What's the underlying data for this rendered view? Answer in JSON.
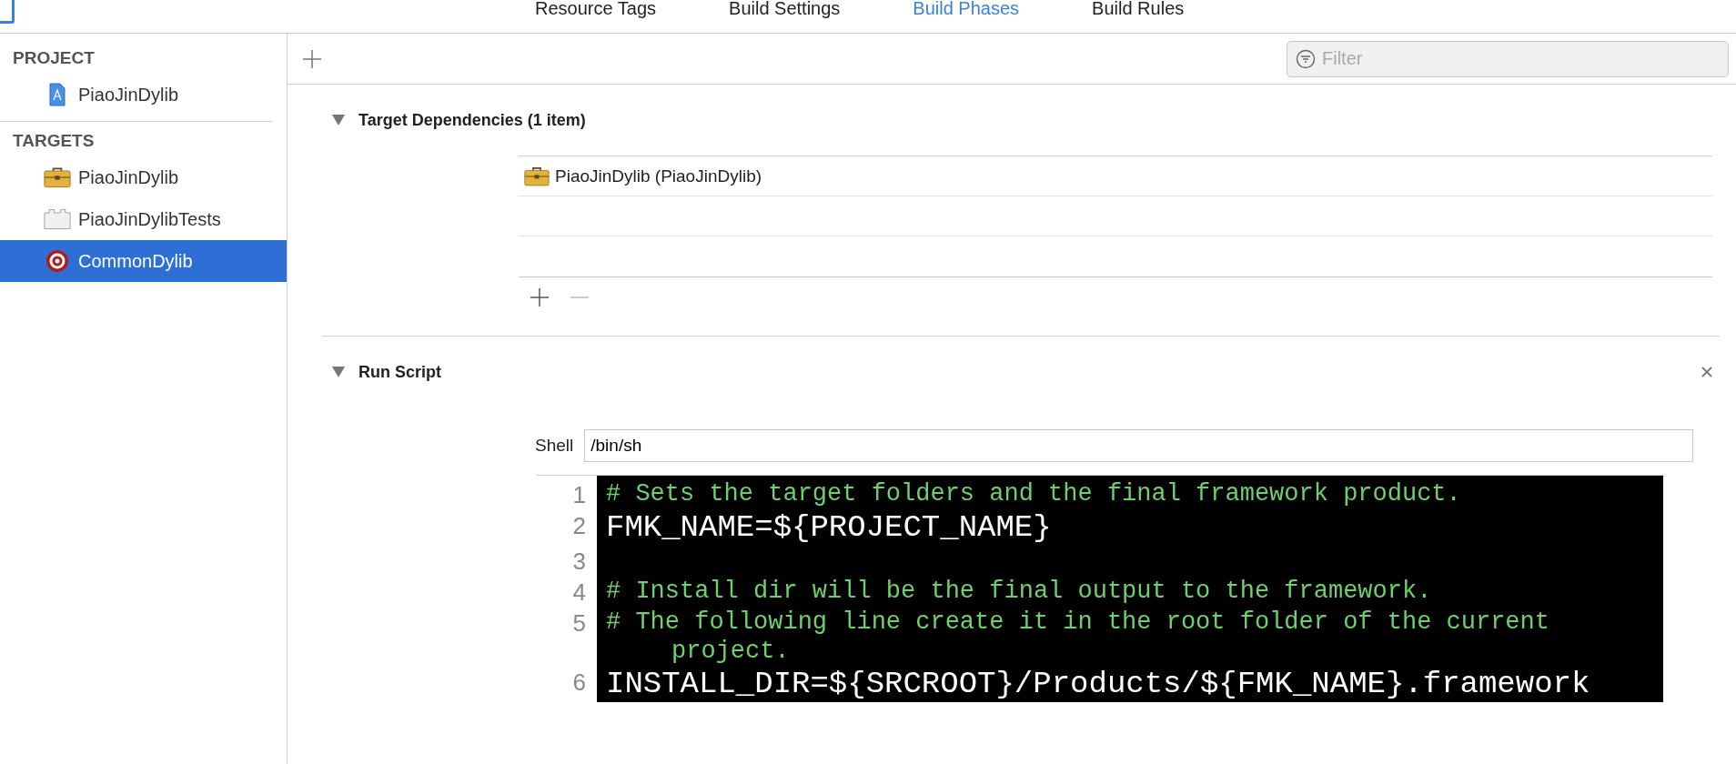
{
  "tabs": [
    {
      "label": "Resource Tags",
      "selected": false
    },
    {
      "label": "Build Settings",
      "selected": false
    },
    {
      "label": "Build Phases",
      "selected": true
    },
    {
      "label": "Build Rules",
      "selected": false
    }
  ],
  "sidebar": {
    "sections": [
      {
        "title": "PROJECT",
        "items": [
          {
            "label": "PiaoJinDylib",
            "kind": "project",
            "selected": false
          }
        ]
      },
      {
        "title": "TARGETS",
        "items": [
          {
            "label": "PiaoJinDylib",
            "kind": "framework",
            "selected": false
          },
          {
            "label": "PiaoJinDylibTests",
            "kind": "tests",
            "selected": false
          },
          {
            "label": "CommonDylib",
            "kind": "aggregate",
            "selected": true
          }
        ]
      }
    ]
  },
  "filter": {
    "placeholder": "Filter"
  },
  "phases": [
    {
      "kind": "dependencies",
      "title": "Target Dependencies (1 item)",
      "expanded": true,
      "items": [
        {
          "label": "PiaoJinDylib (PiaoJinDylib)"
        }
      ]
    },
    {
      "kind": "script",
      "title": "Run Script",
      "expanded": true,
      "shell_label": "Shell",
      "shell": "/bin/sh",
      "lines": [
        {
          "number": "1",
          "kind": "comment",
          "text": "# Sets the target folders and the final framework product."
        },
        {
          "number": "2",
          "kind": "code",
          "text": "FMK_NAME=${PROJECT_NAME}"
        },
        {
          "number": "3",
          "kind": "code"
        },
        {
          "number": "4",
          "kind": "comment",
          "text": "# Install dir will be the final output to the framework."
        },
        {
          "number": "5",
          "kind": "comment",
          "text": "# The following line create it in the root folder of the current project."
        },
        {
          "number": "6",
          "kind": "code",
          "text": "INSTALL_DIR=${SRCROOT}/Products/${FMK_NAME}.framework"
        }
      ]
    }
  ]
}
